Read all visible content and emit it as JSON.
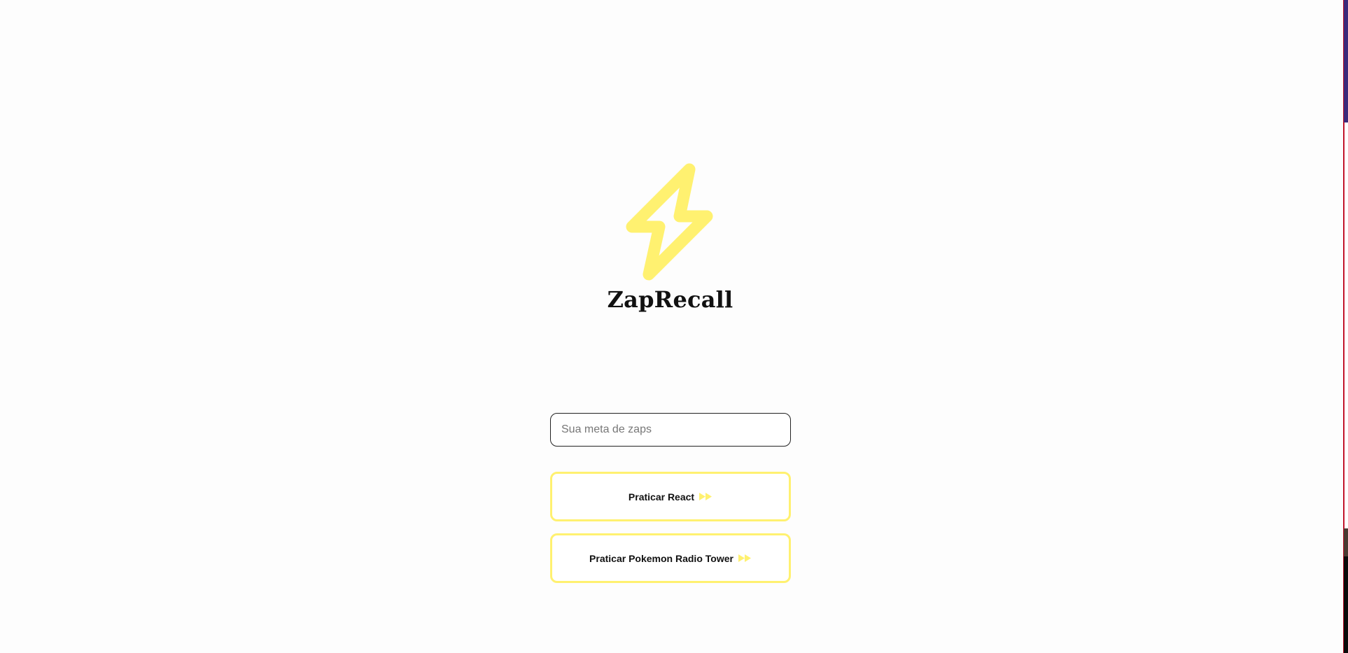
{
  "app": {
    "title": "ZapRecall",
    "logo_icon": "lightning-bolt-icon",
    "accent_color": "#fff170"
  },
  "goal_input": {
    "placeholder": "Sua meta de zaps",
    "value": ""
  },
  "decks": [
    {
      "label": "Praticar React",
      "icon": "play-forward-icon"
    },
    {
      "label": "Praticar Pokemon Radio Tower",
      "icon": "play-forward-icon"
    }
  ]
}
